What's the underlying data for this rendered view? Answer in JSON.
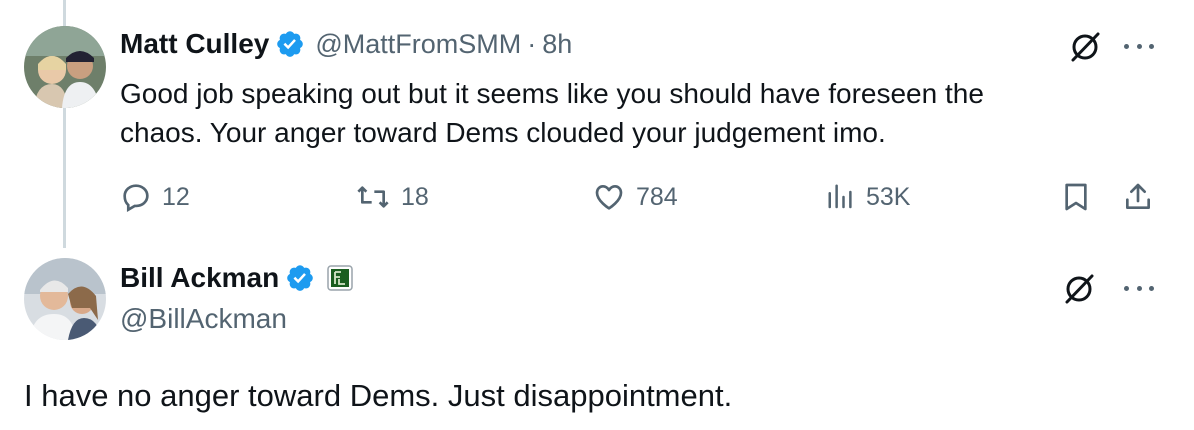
{
  "reply": {
    "name": "Matt Culley",
    "handle": "@MattFromSMM",
    "separator": "·",
    "time": "8h",
    "text_line1": "Good job speaking out but it seems like you should have foreseen the",
    "text_line2": "chaos. Your anger toward Dems clouded your judgement imo.",
    "stats": {
      "replies": "12",
      "reposts": "18",
      "likes": "784",
      "views": "53K"
    }
  },
  "main": {
    "name": "Bill Ackman",
    "handle": "@BillAckman",
    "text": "I have no anger toward Dems. Just disappointment."
  },
  "colors": {
    "verified": "#1d9bf0",
    "muted": "#536471",
    "thread_line": "#cfd9de",
    "affiliate_badge": "#1b5e20"
  },
  "icons": [
    "verified-badge-icon",
    "grok-icon",
    "more-icon",
    "reply-icon",
    "repost-icon",
    "like-icon",
    "views-icon",
    "bookmark-icon",
    "share-icon",
    "affiliate-badge-icon"
  ]
}
